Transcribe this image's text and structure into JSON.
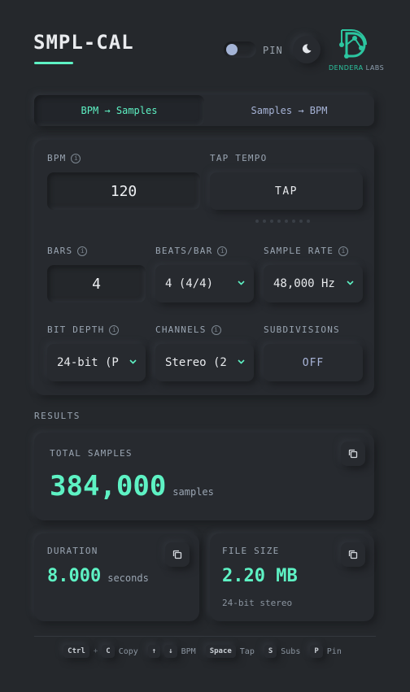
{
  "app": {
    "title": "SMPL-CAL"
  },
  "header": {
    "pin_label": "PIN",
    "theme_icon": "moon-icon",
    "logo_name": "DENDERA",
    "logo_suffix": "LABS"
  },
  "mode_tabs": [
    {
      "label": "BPM → Samples",
      "active": true
    },
    {
      "label": "Samples → BPM",
      "active": false
    }
  ],
  "inputs": {
    "bpm": {
      "label": "BPM",
      "value": "120"
    },
    "tap_tempo": {
      "label": "TAP TEMPO",
      "button": "TAP"
    },
    "bars": {
      "label": "BARS",
      "value": "4"
    },
    "beats_per_bar": {
      "label": "BEATS/BAR",
      "value": "4 (4/4)"
    },
    "sample_rate": {
      "label": "SAMPLE RATE",
      "value": "48,000 Hz"
    },
    "bit_depth": {
      "label": "BIT DEPTH",
      "value": "24-bit (P"
    },
    "channels": {
      "label": "CHANNELS",
      "value": "Stereo (2"
    },
    "subdivisions": {
      "label": "SUBDIVISIONS",
      "value": "OFF"
    }
  },
  "results": {
    "section_label": "RESULTS",
    "total_samples": {
      "label": "TOTAL SAMPLES",
      "value": "384,000",
      "unit": "samples"
    },
    "duration": {
      "label": "DURATION",
      "value": "8.000",
      "unit": "seconds"
    },
    "file_size": {
      "label": "FILE SIZE",
      "value": "2.20 MB",
      "detail": "24-bit stereo"
    }
  },
  "shortcuts": [
    {
      "keys": [
        "Ctrl",
        "C"
      ],
      "joiner": "+",
      "action": "Copy"
    },
    {
      "keys": [
        "↑",
        "↓"
      ],
      "joiner": "",
      "action": "BPM"
    },
    {
      "keys": [
        "Space"
      ],
      "joiner": "",
      "action": "Tap"
    },
    {
      "keys": [
        "S"
      ],
      "joiner": "",
      "action": "Subs"
    },
    {
      "keys": [
        "P"
      ],
      "joiner": "",
      "action": "Pin"
    }
  ],
  "colors": {
    "accent": "#5ef2c4",
    "background": "#25282c",
    "secondary": "#a6b3d6"
  }
}
